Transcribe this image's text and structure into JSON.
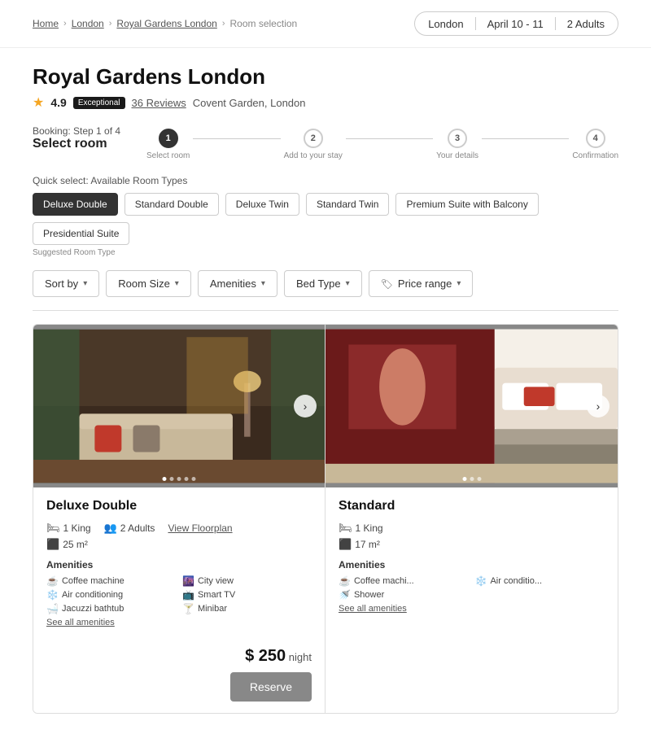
{
  "breadcrumb": {
    "home": "Home",
    "london": "London",
    "hotel": "Royal Gardens London",
    "current": "Room selection"
  },
  "search_summary": {
    "location": "London",
    "dates": "April 10 - 11",
    "guests": "2 Adults"
  },
  "hotel": {
    "name": "Royal Gardens London",
    "rating": "4.9",
    "rating_badge": "Exceptional",
    "reviews": "36 Reviews",
    "location": "Covent Garden, London"
  },
  "booking": {
    "step_label": "Booking: Step 1 of 4",
    "select_room": "Select room",
    "steps": [
      {
        "num": "1",
        "label": "Select room",
        "active": true
      },
      {
        "num": "2",
        "label": "Add to your stay",
        "active": false
      },
      {
        "num": "3",
        "label": "Your details",
        "active": false
      },
      {
        "num": "4",
        "label": "Confirmation",
        "active": false
      }
    ]
  },
  "quick_select": {
    "label": "Quick select: Available Room Types",
    "suggested_label": "Suggested Room Type",
    "buttons": [
      {
        "label": "Deluxe Double",
        "selected": true
      },
      {
        "label": "Standard Double",
        "selected": false
      },
      {
        "label": "Deluxe Twin",
        "selected": false
      },
      {
        "label": "Standard Twin",
        "selected": false
      },
      {
        "label": "Premium Suite with Balcony",
        "selected": false
      },
      {
        "label": "Presidential Suite",
        "selected": false
      }
    ]
  },
  "filters": [
    {
      "label": "Sort by",
      "icon": null
    },
    {
      "label": "Room Size",
      "icon": null
    },
    {
      "label": "Amenities",
      "icon": null
    },
    {
      "label": "Bed Type",
      "icon": null
    },
    {
      "label": "Price range",
      "icon": "tag"
    }
  ],
  "rooms": [
    {
      "name": "Deluxe Double",
      "bed": "1 King",
      "guests": "2 Adults",
      "size": "25 m²",
      "floorplan": "View Floorplan",
      "amenities_label": "Amenities",
      "amenities": [
        {
          "icon": "☕",
          "label": "Coffee machine"
        },
        {
          "icon": "🌆",
          "label": "City view"
        },
        {
          "icon": "❄️",
          "label": "Air conditioning"
        },
        {
          "icon": "📺",
          "label": "Smart TV"
        },
        {
          "icon": "🛁",
          "label": "Jacuzzi bathtub"
        },
        {
          "icon": "🍸",
          "label": "Minibar"
        }
      ],
      "see_all": "See all amenities",
      "price": "$ 250",
      "per_night": "night",
      "reserve": "Reserve",
      "dots": 5,
      "active_dot": 0,
      "img_color": "#5a4a3a"
    },
    {
      "name": "Standard",
      "bed": "1 King",
      "guests": null,
      "size": "17 m²",
      "floorplan": null,
      "amenities_label": "Amenities",
      "amenities": [
        {
          "icon": "☕",
          "label": "Coffee machi..."
        },
        {
          "icon": "❄️",
          "label": "Air conditio..."
        },
        {
          "icon": "🚿",
          "label": "Shower"
        }
      ],
      "see_all": "See all amenities",
      "price": null,
      "per_night": null,
      "reserve": null,
      "dots": 3,
      "active_dot": 0,
      "img_color": "#6b2a2a"
    }
  ]
}
